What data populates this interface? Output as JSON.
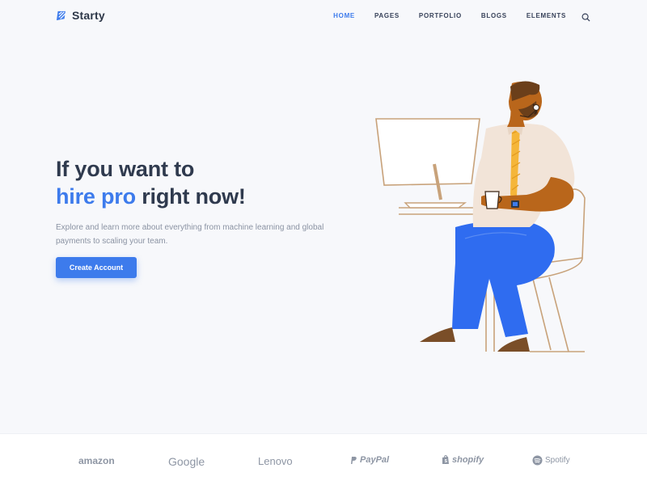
{
  "header": {
    "brand": "Starty",
    "nav": [
      "HOME",
      "PAGES",
      "PORTFOLIO",
      "BLOGS",
      "ELEMENTS"
    ],
    "active_index": 0,
    "search_icon": "search-icon"
  },
  "hero": {
    "title_line1": "If you want to",
    "title_accent": "hire pro",
    "title_rest": " right now!",
    "description": "Explore and learn more about everything from machine learning and global payments to scaling your team.",
    "cta_label": "Create Account"
  },
  "brands": [
    "amazon",
    "Google",
    "Lenovo",
    "PayPal",
    "shopify",
    "Spotify"
  ],
  "colors": {
    "accent": "#3d7bec",
    "heading": "#2f3a4e",
    "text_muted": "#8b93a3",
    "skin": "#b9661b",
    "pants": "#2f6cf0",
    "tie": "#f5b63a",
    "shirt": "#f2e4d8",
    "outline": "#c8a27a"
  }
}
